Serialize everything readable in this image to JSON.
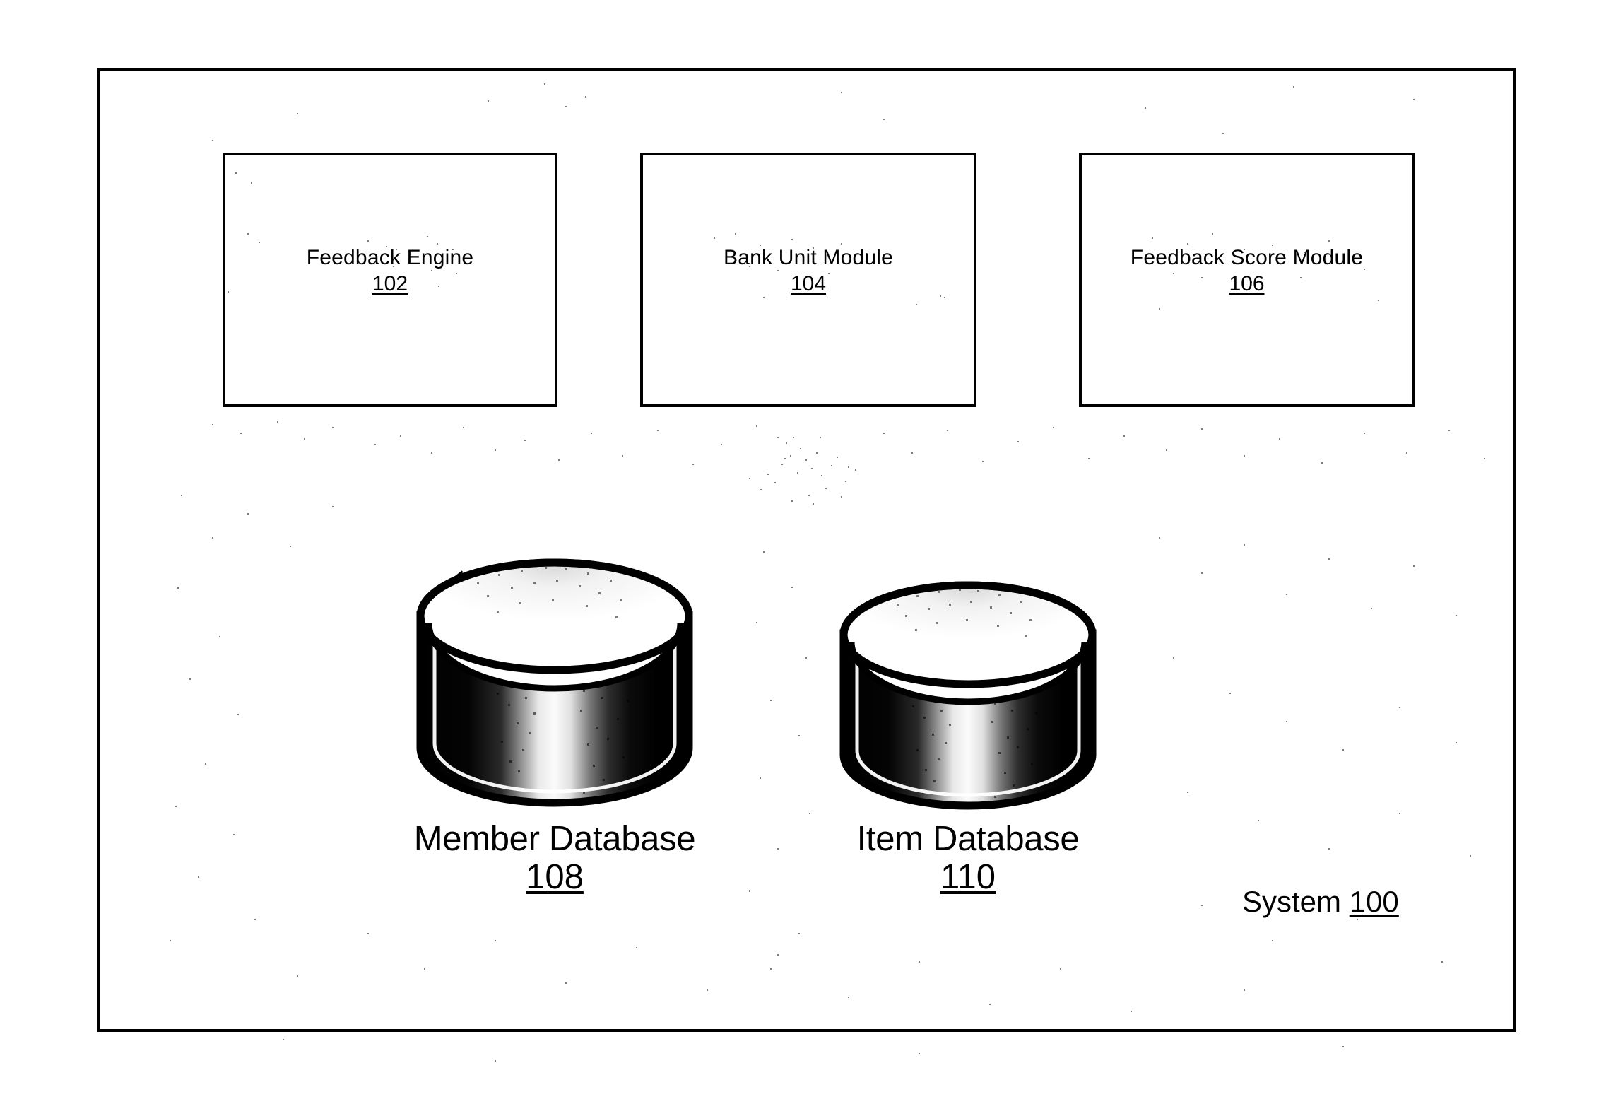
{
  "diagram": {
    "figure_caption": "System 100",
    "system": {
      "label_prefix": "System ",
      "reference_numeral": "100"
    },
    "modules": [
      {
        "title": "Feedback Engine",
        "reference_numeral": "102",
        "icon": "rectangle-block-icon"
      },
      {
        "title": "Bank Unit Module",
        "reference_numeral": "104",
        "icon": "rectangle-block-icon"
      },
      {
        "title": "Feedback Score Module",
        "reference_numeral": "106",
        "icon": "rectangle-block-icon"
      }
    ],
    "databases": [
      {
        "title": "Member Database",
        "reference_numeral": "108",
        "icon": "database-cylinder-icon"
      },
      {
        "title": "Item Database",
        "reference_numeral": "110",
        "icon": "database-cylinder-icon"
      }
    ],
    "colors": {
      "ink": "#000000",
      "paper": "#ffffff"
    }
  }
}
